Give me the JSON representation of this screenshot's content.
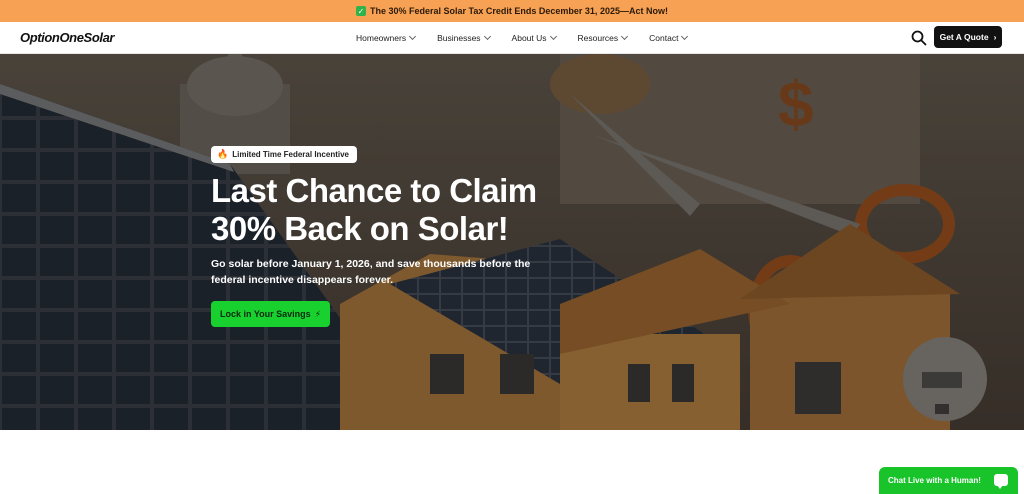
{
  "banner": {
    "icon": "check-box-icon",
    "text": "The 30% Federal Solar Tax Credit Ends December 31, 2025—Act Now!",
    "bg_color": "#f7a154"
  },
  "nav": {
    "logo": "OptionOneSolar",
    "items": [
      {
        "label": "Homeowners"
      },
      {
        "label": "Businesses"
      },
      {
        "label": "About Us"
      },
      {
        "label": "Resources"
      },
      {
        "label": "Contact"
      }
    ],
    "search_icon": "search-icon",
    "quote_button": "Get A Quote"
  },
  "hero": {
    "badge": "Limited Time Federal Incentive",
    "badge_icon": "flame-icon",
    "headline_line1": "Last Chance to Claim",
    "headline_line2": "30% Back on Solar!",
    "subtext": "Go solar before January 1, 2026, and save thousands before the federal incentive disappears forever.",
    "cta_label": "Lock in Your Savings",
    "cta_icon": "lightning-icon",
    "cta_color": "#18d12f"
  },
  "chat": {
    "label": "Chat Live with a Human!",
    "icon": "chat-bubble-icon",
    "color": "#18c42a"
  }
}
